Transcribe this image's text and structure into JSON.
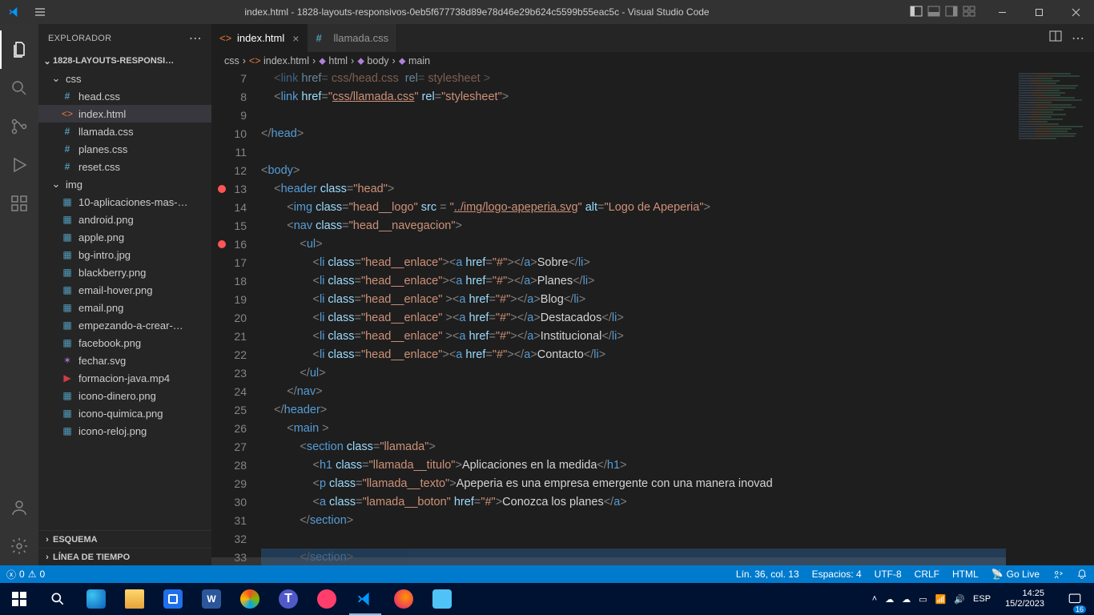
{
  "window": {
    "title": "index.html - 1828-layouts-responsivos-0eb5f677738d89e78d46e29b624c5599b55eac5c - Visual Studio Code"
  },
  "sidebar": {
    "title": "EXPLORADOR",
    "folder": "1828-LAYOUTS-RESPONSI…",
    "tree": [
      {
        "type": "folder",
        "label": "css",
        "open": true,
        "indent": 0
      },
      {
        "type": "file",
        "label": "head.css",
        "icon": "css",
        "indent": 1
      },
      {
        "type": "file",
        "label": "index.html",
        "icon": "html",
        "indent": 1,
        "selected": true
      },
      {
        "type": "file",
        "label": "llamada.css",
        "icon": "css",
        "indent": 1
      },
      {
        "type": "file",
        "label": "planes.css",
        "icon": "css",
        "indent": 1
      },
      {
        "type": "file",
        "label": "reset.css",
        "icon": "css",
        "indent": 1
      },
      {
        "type": "folder",
        "label": "img",
        "open": true,
        "indent": 0
      },
      {
        "type": "file",
        "label": "10-aplicaciones-mas-…",
        "icon": "img",
        "indent": 1
      },
      {
        "type": "file",
        "label": "android.png",
        "icon": "img",
        "indent": 1
      },
      {
        "type": "file",
        "label": "apple.png",
        "icon": "img",
        "indent": 1
      },
      {
        "type": "file",
        "label": "bg-intro.jpg",
        "icon": "img",
        "indent": 1
      },
      {
        "type": "file",
        "label": "blackberry.png",
        "icon": "img",
        "indent": 1
      },
      {
        "type": "file",
        "label": "email-hover.png",
        "icon": "img",
        "indent": 1
      },
      {
        "type": "file",
        "label": "email.png",
        "icon": "img",
        "indent": 1
      },
      {
        "type": "file",
        "label": "empezando-a-crear-…",
        "icon": "img",
        "indent": 1
      },
      {
        "type": "file",
        "label": "facebook.png",
        "icon": "img",
        "indent": 1
      },
      {
        "type": "file",
        "label": "fechar.svg",
        "icon": "svg",
        "indent": 1
      },
      {
        "type": "file",
        "label": "formacion-java.mp4",
        "icon": "media",
        "indent": 1
      },
      {
        "type": "file",
        "label": "icono-dinero.png",
        "icon": "img",
        "indent": 1
      },
      {
        "type": "file",
        "label": "icono-quimica.png",
        "icon": "img",
        "indent": 1
      },
      {
        "type": "file",
        "label": "icono-reloj.png",
        "icon": "img",
        "indent": 1
      }
    ],
    "outline": "ESQUEMA",
    "timeline": "LÍNEA DE TIEMPO"
  },
  "tabs": [
    {
      "label": "index.html",
      "icon": "html",
      "active": true
    },
    {
      "label": "llamada.css",
      "icon": "css",
      "active": false
    }
  ],
  "breadcrumb": [
    "css",
    "index.html",
    "html",
    "body",
    "main"
  ],
  "gutter": {
    "start": 7,
    "end": 33,
    "breakpoints": [
      13,
      16
    ]
  },
  "code_lines": [
    "    <p>&lt;</p><t>link</t> <a>href</a><p>=</p><s> css/head.css </s> <a>rel</a><p>=</p><s> stylesheet </s><p>&gt;</p>",
    "    <p>&lt;</p><t>link</t> <a>href</a><p>=</p><s>\"<u>css/llamada.css</u>\"</s> <a>rel</a><p>=</p><s>\"stylesheet\"</s><p>&gt;</p>",
    "",
    "<p>&lt;/</p><t>head</t><p>&gt;</p>",
    "",
    "<p>&lt;</p><t>body</t><p>&gt;</p>",
    "    <p>&lt;</p><t>header</t> <a>class</a><p>=</p><s>\"head\"</s><p>&gt;</p>",
    "        <p>&lt;</p><t>img</t> <a>class</a><p>=</p><s>\"head__logo\"</s> <a>src</a> <p>=</p> <s>\"<u>../img/logo-apeperia.svg</u>\"</s> <a>alt</a><p>=</p><s>\"Logo de Apeperia\"</s><p>&gt;</p>",
    "        <p>&lt;</p><t>nav</t> <a>class</a><p>=</p><s>\"head__navegacion\"</s><p>&gt;</p>",
    "            <p>&lt;</p><t>ul</t><p>&gt;</p>",
    "                <p>&lt;</p><t>li</t> <a>class</a><p>=</p><s>\"head__enlace\"</s><p>&gt;&lt;</p><t>a</t> <a>href</a><p>=</p><s>\"#\"</s><p>&gt;&lt;/</p><t>a</t><p>&gt;</p>Sobre<p>&lt;/</p><t>li</t><p>&gt;</p>",
    "                <p>&lt;</p><t>li</t> <a>class</a><p>=</p><s>\"head__enlace\"</s><p>&gt;&lt;</p><t>a</t> <a>href</a><p>=</p><s>\"#\"</s><p>&gt;&lt;/</p><t>a</t><p>&gt;</p>Planes<p>&lt;/</p><t>li</t><p>&gt;</p>",
    "                <p>&lt;</p><t>li</t> <a>class</a><p>=</p><s>\"head__enlace\"</s> <p>&gt;&lt;</p><t>a</t> <a>href</a><p>=</p><s>\"#\"</s><p>&gt;&lt;/</p><t>a</t><p>&gt;</p>Blog<p>&lt;/</p><t>li</t><p>&gt;</p>",
    "                <p>&lt;</p><t>li</t> <a>class</a><p>=</p><s>\"head__enlace\"</s> <p>&gt;&lt;</p><t>a</t> <a>href</a><p>=</p><s>\"#\"</s><p>&gt;&lt;/</p><t>a</t><p>&gt;</p>Destacados<p>&lt;/</p><t>li</t><p>&gt;</p>",
    "                <p>&lt;</p><t>li</t> <a>class</a><p>=</p><s>\"head__enlace\"</s> <p>&gt;&lt;</p><t>a</t> <a>href</a><p>=</p><s>\"#\"</s><p>&gt;&lt;/</p><t>a</t><p>&gt;</p>Institucional<p>&lt;/</p><t>li</t><p>&gt;</p>",
    "                <p>&lt;</p><t>li</t> <a>class</a><p>=</p><s>\"head__enlace\"</s><p>&gt;&lt;</p><t>a</t> <a>href</a><p>=</p><s>\"#\"</s><p>&gt;&lt;/</p><t>a</t><p>&gt;</p>Contacto<p>&lt;/</p><t>li</t><p>&gt;</p>",
    "            <p>&lt;/</p><t>ul</t><p>&gt;</p>",
    "        <p>&lt;/</p><t>nav</t><p>&gt;</p>",
    "    <p>&lt;/</p><t>header</t><p>&gt;</p>",
    "        <p>&lt;</p><t>main</t> <p>&gt;</p>",
    "            <p>&lt;</p><t>section</t> <a>class</a><p>=</p><s>\"llamada\"</s><p>&gt;</p>",
    "                <p>&lt;</p><t>h1</t> <a>class</a><p>=</p><s>\"llamada__titulo\"</s><p>&gt;</p>Aplicaciones en la medida<p>&lt;/</p><t>h1</t><p>&gt;</p>",
    "                <p>&lt;</p><t>p</t> <a>class</a><p>=</p><s>\"llamada__texto\"</s><p>&gt;</p>Apeperia es una empresa emergente con una manera inovad",
    "                <p>&lt;</p><t>a</t> <a>class</a><p>=</p><s>\"lamada__boton\"</s> <a>href</a><p>=</p><s>\"#\"</s><p>&gt;</p>Conozca los planes<p>&lt;/</p><t>a</t><p>&gt;</p>",
    "            <p>&lt;/</p><t>section</t><p>&gt;</p>",
    "",
    "            <p>&lt;/</p><t>section</t><p>&gt;</p>"
  ],
  "status": {
    "errors": "0",
    "warnings": "0",
    "pos": "Lín. 36, col. 13",
    "spaces": "Espacios: 4",
    "enc": "UTF-8",
    "eol": "CRLF",
    "lang": "HTML",
    "golive": "Go Live"
  },
  "taskbar": {
    "lang": "ESP",
    "time": "14:25",
    "date": "15/2/2023",
    "notif": "16"
  }
}
